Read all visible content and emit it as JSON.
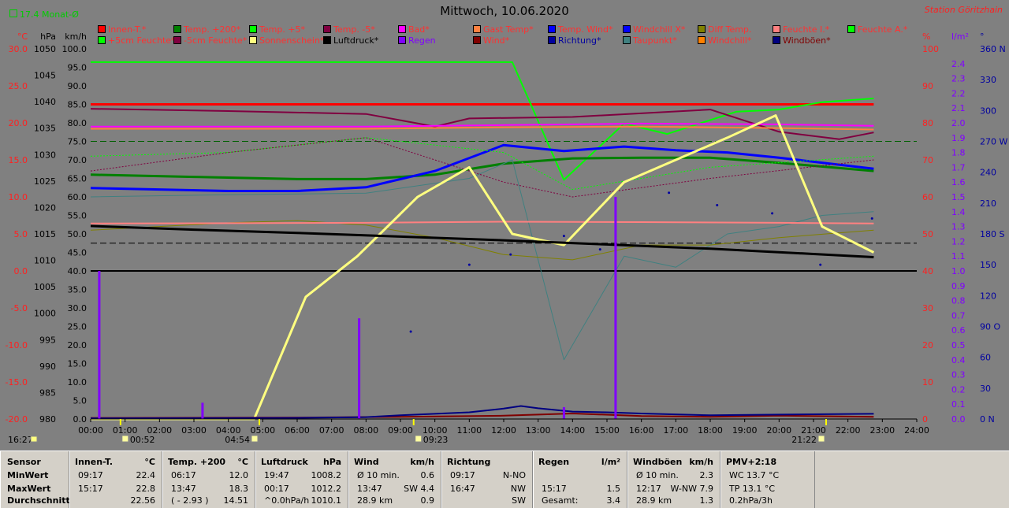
{
  "header": {
    "title": "Mittwoch, 10.06.2020",
    "station": "Station Göritzhain",
    "top_left": "17.4 Monat-Ø"
  },
  "legend": [
    {
      "label": "Innen-T.*",
      "color": "#ff0000",
      "text_color": "#ff3030"
    },
    {
      "label": "Temp. +200*",
      "color": "#008000",
      "text_color": "#ff3030"
    },
    {
      "label": "Temp. +5*",
      "color": "#00ff00",
      "text_color": "#ff3030"
    },
    {
      "label": "Temp. -5*",
      "color": "#800040",
      "text_color": "#ff3030"
    },
    {
      "label": "Bad*",
      "color": "#ff00ff",
      "text_color": "#ff3030"
    },
    {
      "label": "Gast Temp*",
      "color": "#ff8040",
      "text_color": "#ff3030"
    },
    {
      "label": "Temp. Wind*",
      "color": "#0000ff",
      "text_color": "#ff3030"
    },
    {
      "label": "Windchill X*",
      "color": "#0000ff",
      "text_color": "#ff3030"
    },
    {
      "label": "Diff Temp.",
      "color": "#808000",
      "text_color": "#ff3030"
    },
    {
      "label": "Feuchte I.*",
      "color": "#ff8080",
      "text_color": "#ff3030"
    },
    {
      "label": "Feuchte A.*",
      "color": "#00ff00",
      "text_color": "#ff3030"
    },
    {
      "label": "+5cm Feuchte*",
      "color": "#00ff00",
      "text_color": "#ff3030"
    },
    {
      "label": "-5cm Feuchte*",
      "color": "#800040",
      "text_color": "#ff3030"
    },
    {
      "label": "Sonnenschein*",
      "color": "#ffff80",
      "text_color": "#ff3030"
    },
    {
      "label": "Luftdruck*",
      "color": "#000000",
      "text_color": "#000000"
    },
    {
      "label": "Regen",
      "color": "#8000ff",
      "text_color": "#8000ff"
    },
    {
      "label": "Wind*",
      "color": "#800000",
      "text_color": "#ff3030"
    },
    {
      "label": "Richtung*",
      "color": "#0000a0",
      "text_color": "#0000a0"
    },
    {
      "label": "Taupunkt*",
      "color": "#408080",
      "text_color": "#ff3030"
    },
    {
      "label": "Windchill*",
      "color": "#ff8000",
      "text_color": "#ff3030"
    },
    {
      "label": "Windböen*",
      "color": "#000080",
      "text_color": "#800000"
    }
  ],
  "chart_data": {
    "type": "line",
    "x_unit": "hour",
    "x_range": [
      0,
      24
    ],
    "x_ticks": [
      "00:00",
      "01:00",
      "02:00",
      "03:00",
      "04:00",
      "05:00",
      "06:00",
      "07:00",
      "08:00",
      "09:00",
      "10:00",
      "11:00",
      "12:00",
      "13:00",
      "14:00",
      "15:00",
      "16:00",
      "17:00",
      "18:00",
      "19:00",
      "20:00",
      "21:00",
      "22:00",
      "23:00",
      "24:00"
    ],
    "axes": {
      "temp_c": {
        "label": "°C",
        "color": "#ff2020",
        "range": [
          -20,
          30
        ],
        "ticks": [
          "30.0",
          "25.0",
          "20.0",
          "15.0",
          "10.0",
          "5.0",
          "0.0",
          "-5.0",
          "-10.0",
          "-15.0",
          "-20.0"
        ]
      },
      "pressure_hpa": {
        "label": "hPa",
        "color": "#000000",
        "range": [
          980,
          1050
        ],
        "ticks": [
          "1050",
          "1045",
          "1040",
          "1035",
          "1030",
          "1025",
          "1020",
          "1015",
          "1010",
          "1005",
          "1000",
          "995",
          "990",
          "985",
          "980"
        ]
      },
      "wind_kmh": {
        "label": "km/h",
        "color": "#000000",
        "range": [
          0,
          100
        ],
        "ticks": [
          "100.0",
          "95.0",
          "90.0",
          "85.0",
          "80.0",
          "75.0",
          "70.0",
          "65.0",
          "60.0",
          "55.0",
          "50.0",
          "45.0",
          "40.0",
          "35.0",
          "30.0",
          "25.0",
          "20.0",
          "15.0",
          "10.0",
          "5.0",
          "0.0"
        ]
      },
      "humidity_pct": {
        "label": "%",
        "color": "#ff2020",
        "range": [
          0,
          100
        ],
        "ticks": [
          "100",
          "90",
          "80",
          "70",
          "60",
          "50",
          "40",
          "30",
          "20",
          "10",
          "0"
        ]
      },
      "rain_lm2": {
        "label": "l/m²",
        "color": "#8000ff",
        "range": [
          0,
          2.5
        ],
        "ticks": [
          "2.4",
          "2.3",
          "2.2",
          "2.1",
          "2.0",
          "1.9",
          "1.8",
          "1.7",
          "1.6",
          "1.5",
          "1.4",
          "1.3",
          "1.2",
          "1.1",
          "1.0",
          "0.9",
          "0.8",
          "0.7",
          "0.6",
          "0.5",
          "0.4",
          "0.3",
          "0.2",
          "0.1",
          "0.0"
        ]
      },
      "direction_deg": {
        "label": "°",
        "color": "#0000a0",
        "range": [
          0,
          360
        ],
        "ticks": [
          "360 N",
          "330",
          "300",
          "270 W",
          "240",
          "210",
          "180 S",
          "150",
          "120",
          "90 O",
          "60",
          "30",
          "0 N"
        ]
      }
    },
    "series": [
      {
        "name": "Innen-T.*",
        "axis": "temp_c",
        "color": "#ff0000",
        "width": 3,
        "x": [
          0,
          4,
          8,
          12,
          16,
          20,
          22.75
        ],
        "y": [
          22.5,
          22.5,
          22.5,
          22.5,
          22.5,
          22.5,
          22.5
        ]
      },
      {
        "name": "Temp. +5*",
        "axis": "temp_c",
        "color": "#00ff00",
        "width": 2,
        "x": [
          0,
          8,
          12.25,
          13.75,
          15.5,
          16.75,
          18.75,
          20,
          21.25,
          22.75
        ],
        "y": [
          28.2,
          28.2,
          28.2,
          12.3,
          19.9,
          18.5,
          21.5,
          21.8,
          22.8,
          23.3
        ]
      },
      {
        "name": "Temp. -5*",
        "axis": "temp_c",
        "color": "#800040",
        "width": 2,
        "x": [
          0,
          4,
          8,
          10,
          11,
          14,
          18,
          20,
          21.75,
          22.75
        ],
        "y": [
          21.9,
          21.6,
          21.2,
          19.5,
          20.6,
          20.8,
          21.8,
          18.8,
          17.8,
          18.7
        ]
      },
      {
        "name": "Bad*",
        "axis": "temp_c",
        "color": "#ff00ff",
        "width": 2,
        "x": [
          0,
          4,
          8,
          12,
          16,
          20,
          22.75
        ],
        "y": [
          19.5,
          19.5,
          19.5,
          19.7,
          19.9,
          19.8,
          19.6
        ]
      },
      {
        "name": "Gast Temp*",
        "axis": "temp_c",
        "color": "#ff8040",
        "width": 2,
        "x": [
          0,
          8,
          12,
          16,
          20,
          22.75
        ],
        "y": [
          19.2,
          19.2,
          19.4,
          19.5,
          19.3,
          19.1
        ]
      },
      {
        "name": "Temp. +200*",
        "axis": "temp_c",
        "color": "#008000",
        "width": 3,
        "x": [
          0,
          3,
          6,
          8,
          10,
          12,
          14,
          16,
          18,
          20,
          22.75
        ],
        "y": [
          13.0,
          12.7,
          12.4,
          12.4,
          13.0,
          14.5,
          15.2,
          15.3,
          15.3,
          14.6,
          13.5
        ]
      },
      {
        "name": "Temp. Wind*",
        "axis": "temp_c",
        "color": "#0000ff",
        "width": 3,
        "x": [
          0,
          2,
          4,
          6,
          8,
          10,
          12,
          13.75,
          15.5,
          17,
          18.5,
          20,
          22.75
        ],
        "y": [
          11.2,
          11.0,
          10.8,
          10.8,
          11.3,
          13.5,
          17.0,
          16.2,
          16.8,
          16.3,
          16.0,
          15.3,
          13.8
        ]
      },
      {
        "name": "Taupunkt*",
        "axis": "temp_c",
        "color": "#408080",
        "width": 1,
        "x": [
          0,
          4,
          8,
          11,
          12.25,
          13.75,
          15.5,
          17,
          18.5,
          20,
          21.25,
          22.75
        ],
        "y": [
          10.0,
          10.3,
          10.5,
          12.5,
          15.0,
          -12.0,
          2.0,
          0.5,
          5.0,
          6.0,
          7.5,
          8.0
        ]
      },
      {
        "name": "Diff Temp.",
        "axis": "temp_c",
        "color": "#808000",
        "width": 1,
        "x": [
          0,
          2,
          4,
          6,
          8,
          10,
          12,
          14,
          16,
          18,
          20,
          22.75
        ],
        "y": [
          5.5,
          6.0,
          6.5,
          6.8,
          6.2,
          4.5,
          2.2,
          1.5,
          3.5,
          3.5,
          4.5,
          5.5
        ]
      },
      {
        "name": "Feuchte I.*",
        "axis": "humidity_pct",
        "color": "#ff8080",
        "width": 2,
        "x": [
          0,
          8,
          12,
          16,
          20,
          22.75
        ],
        "y": [
          52.8,
          53.0,
          53.3,
          53.2,
          53.0,
          52.8
        ]
      },
      {
        "name": "+5cm Feuchte*",
        "axis": "humidity_pct",
        "color": "#00ff00",
        "width": 1,
        "dash": "2,2",
        "x": [
          0,
          4,
          8,
          12,
          14,
          18,
          22.75
        ],
        "y": [
          71,
          72,
          76,
          72,
          62,
          68,
          71
        ]
      },
      {
        "name": "-5cm Feuchte*",
        "axis": "humidity_pct",
        "color": "#800040",
        "width": 1,
        "dash": "2,2",
        "x": [
          0,
          4,
          8,
          12,
          14,
          18,
          22.75
        ],
        "y": [
          67,
          72,
          76,
          64,
          60,
          65,
          70
        ]
      },
      {
        "name": "Sonnenschein*",
        "axis": "wind_kmh",
        "color": "#ffff80",
        "width": 3,
        "x": [
          0,
          4.75,
          6.25,
          7.75,
          9.5,
          11,
          12.25,
          13.75,
          15.5,
          17,
          18.5,
          19.9,
          21.25,
          22.75
        ],
        "y": [
          0,
          0,
          33,
          44,
          60,
          68,
          50,
          47,
          64,
          70,
          76,
          82,
          52,
          45
        ]
      },
      {
        "name": "Luftdruck*",
        "axis": "pressure_hpa",
        "color": "#000000",
        "width": 3,
        "x": [
          0,
          3,
          6,
          9,
          12,
          15,
          18,
          21,
          22.75
        ],
        "y": [
          1016.5,
          1015.8,
          1015.2,
          1014.5,
          1013.8,
          1013.0,
          1012.2,
          1011.2,
          1010.6
        ]
      },
      {
        "name": "Wind*",
        "axis": "wind_kmh",
        "color": "#800000",
        "width": 2,
        "x": [
          0,
          6,
          9,
          12,
          14,
          16,
          18,
          20,
          22.75
        ],
        "y": [
          0.3,
          0.4,
          0.6,
          0.9,
          1.5,
          0.8,
          0.6,
          0.9,
          0.6
        ]
      },
      {
        "name": "Windböen*",
        "axis": "wind_kmh",
        "color": "#000080",
        "width": 2,
        "x": [
          0,
          6,
          8,
          9,
          10,
          11,
          12,
          12.5,
          13,
          14,
          15,
          16,
          18,
          20,
          22.75
        ],
        "y": [
          0.2,
          0.3,
          0.5,
          1.0,
          1.4,
          1.8,
          2.8,
          3.5,
          2.9,
          2.0,
          1.8,
          1.5,
          1.0,
          1.2,
          1.4
        ]
      }
    ],
    "rain_bars": [
      {
        "x": 0.25,
        "y": 1.0
      },
      {
        "x": 3.25,
        "y": 0.11
      },
      {
        "x": 7.8,
        "y": 0.68
      },
      {
        "x": 13.75,
        "y": 0.08
      },
      {
        "x": 15.25,
        "y": 1.5
      }
    ],
    "direction_points": [
      {
        "x": 9.3,
        "y": 85
      },
      {
        "x": 11,
        "y": 150
      },
      {
        "x": 12.2,
        "y": 160
      },
      {
        "x": 13.75,
        "y": 178
      },
      {
        "x": 14.8,
        "y": 165
      },
      {
        "x": 16.8,
        "y": 220
      },
      {
        "x": 18.2,
        "y": 208
      },
      {
        "x": 19.8,
        "y": 200
      },
      {
        "x": 21.2,
        "y": 150
      },
      {
        "x": 22.7,
        "y": 195
      }
    ],
    "reference_lines": [
      {
        "axis": "temp_c",
        "value": 0,
        "color": "#000000",
        "style": "solid",
        "width": 2
      },
      {
        "axis": "humidity_pct",
        "value": 75,
        "color": "#006000",
        "style": "dashed",
        "width": 1
      },
      {
        "axis": "pressure_hpa",
        "value": 1013.25,
        "color": "#000000",
        "style": "dashed",
        "width": 1
      }
    ],
    "sun_markers": {
      "sunset_prev": "16:27",
      "moonrise": "00:52",
      "sunrise": "04:54",
      "moonset": "09:23",
      "sunset": "21:22"
    }
  },
  "summary": {
    "row_labels": [
      "Sensor",
      "MinWert",
      "MaxWert",
      "Durchschnitt"
    ],
    "columns": [
      {
        "title": "Innen-T.",
        "unit": "°C",
        "rows": [
          [
            "09:17",
            "22.4"
          ],
          [
            "15:17",
            "22.8"
          ],
          [
            "",
            "22.56"
          ]
        ]
      },
      {
        "title": "Temp. +200",
        "unit": "°C",
        "rows": [
          [
            "06:17",
            "12.0"
          ],
          [
            "13:47",
            "18.3"
          ],
          [
            "( - 2.93 )",
            "14.51"
          ]
        ]
      },
      {
        "title": "Luftdruck",
        "unit": "hPa",
        "rows": [
          [
            "19:47",
            "1008.2"
          ],
          [
            "00:17",
            "1012.2"
          ],
          [
            "^0.0hPa/h",
            "1010.1"
          ]
        ]
      },
      {
        "title": "Wind",
        "unit": "km/h",
        "rows": [
          [
            "Ø 10 min.",
            "0.6"
          ],
          [
            "13:47",
            "SW 4.4"
          ],
          [
            "28.9 km",
            "0.9"
          ]
        ]
      },
      {
        "title": "Richtung",
        "unit": "",
        "rows": [
          [
            "09:17",
            "N-NO"
          ],
          [
            "16:47",
            "NW"
          ],
          [
            "",
            "SW"
          ]
        ]
      },
      {
        "title": "Regen",
        "unit": "l/m²",
        "rows": [
          [
            "",
            ""
          ],
          [
            "15:17",
            "1.5"
          ],
          [
            "Gesamt:",
            "3.4"
          ]
        ]
      },
      {
        "title": "Windböen",
        "unit": "km/h",
        "rows": [
          [
            "Ø 10 min.",
            "2.3"
          ],
          [
            "12:17",
            "W-NW 7.9"
          ],
          [
            "28.9 km",
            "1.3"
          ]
        ]
      },
      {
        "title": "PMV+2:18",
        "unit": "",
        "rows": [
          [
            "WC 13.7 °C",
            ""
          ],
          [
            "TP 13.1 °C",
            ""
          ],
          [
            "0.2hPa/3h",
            ""
          ]
        ]
      }
    ]
  }
}
